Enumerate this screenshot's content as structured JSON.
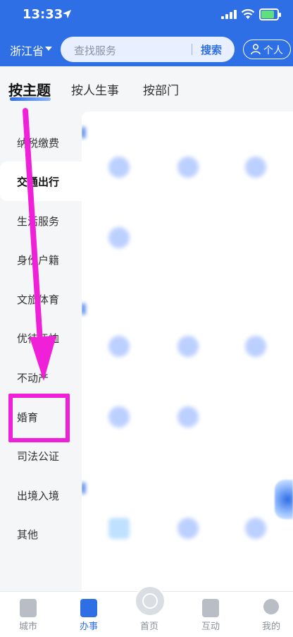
{
  "status_bar": {
    "time": "13:33"
  },
  "header": {
    "province": "浙江省",
    "search_placeholder": "查找服务",
    "search_button": "搜索",
    "personal_button": "个人"
  },
  "tabs": [
    {
      "label": "按主题",
      "active": true
    },
    {
      "label": "按人生事",
      "active": false
    },
    {
      "label": "按部门",
      "active": false
    }
  ],
  "categories": [
    {
      "label": "纳税缴费",
      "active": false
    },
    {
      "label": "交通出行",
      "active": true
    },
    {
      "label": "生活服务",
      "active": false
    },
    {
      "label": "身份户籍",
      "active": false
    },
    {
      "label": "文旅体育",
      "active": false
    },
    {
      "label": "优待抚恤",
      "active": false
    },
    {
      "label": "不动产",
      "active": false
    },
    {
      "label": "婚育",
      "active": false
    },
    {
      "label": "司法公证",
      "active": false
    },
    {
      "label": "出境入境",
      "active": false
    },
    {
      "label": "其他",
      "active": false
    }
  ],
  "bottom_nav": [
    {
      "label": "城市",
      "icon": "city-icon",
      "active": false
    },
    {
      "label": "办事",
      "icon": "affairs-icon",
      "active": true
    },
    {
      "label": "首页",
      "icon": "home-icon",
      "active": false
    },
    {
      "label": "互动",
      "icon": "interact-icon",
      "active": false
    },
    {
      "label": "我的",
      "icon": "profile-icon",
      "active": false
    }
  ],
  "colors": {
    "brand_blue": "#2f6fe6",
    "annotation_magenta": "#f020d8"
  }
}
